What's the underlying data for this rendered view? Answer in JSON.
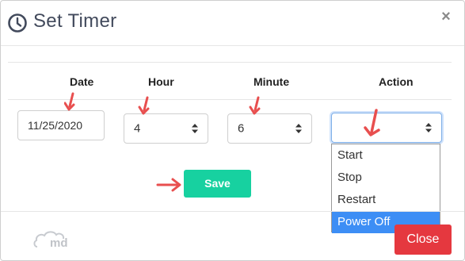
{
  "dialog": {
    "title": "Set Timer",
    "close_symbol": "×"
  },
  "labels": {
    "date": "Date",
    "hour": "Hour",
    "minute": "Minute",
    "action": "Action"
  },
  "fields": {
    "date_value": "11/25/2020",
    "hour_value": "4",
    "minute_value": "6",
    "action_value": ""
  },
  "action_options": [
    "Start",
    "Stop",
    "Restart",
    "Power Off"
  ],
  "selected_option": "Power Off",
  "buttons": {
    "save": "Save",
    "close": "Close"
  },
  "colors": {
    "save": "#17d1a0",
    "close": "#e5383f",
    "option_highlight": "#3d8ef5",
    "arrow": "#e84f4f"
  },
  "icons": [
    "clock-icon",
    "close-icon",
    "sort-icon",
    "arrow-icon",
    "md-cloud-logo-icon"
  ]
}
